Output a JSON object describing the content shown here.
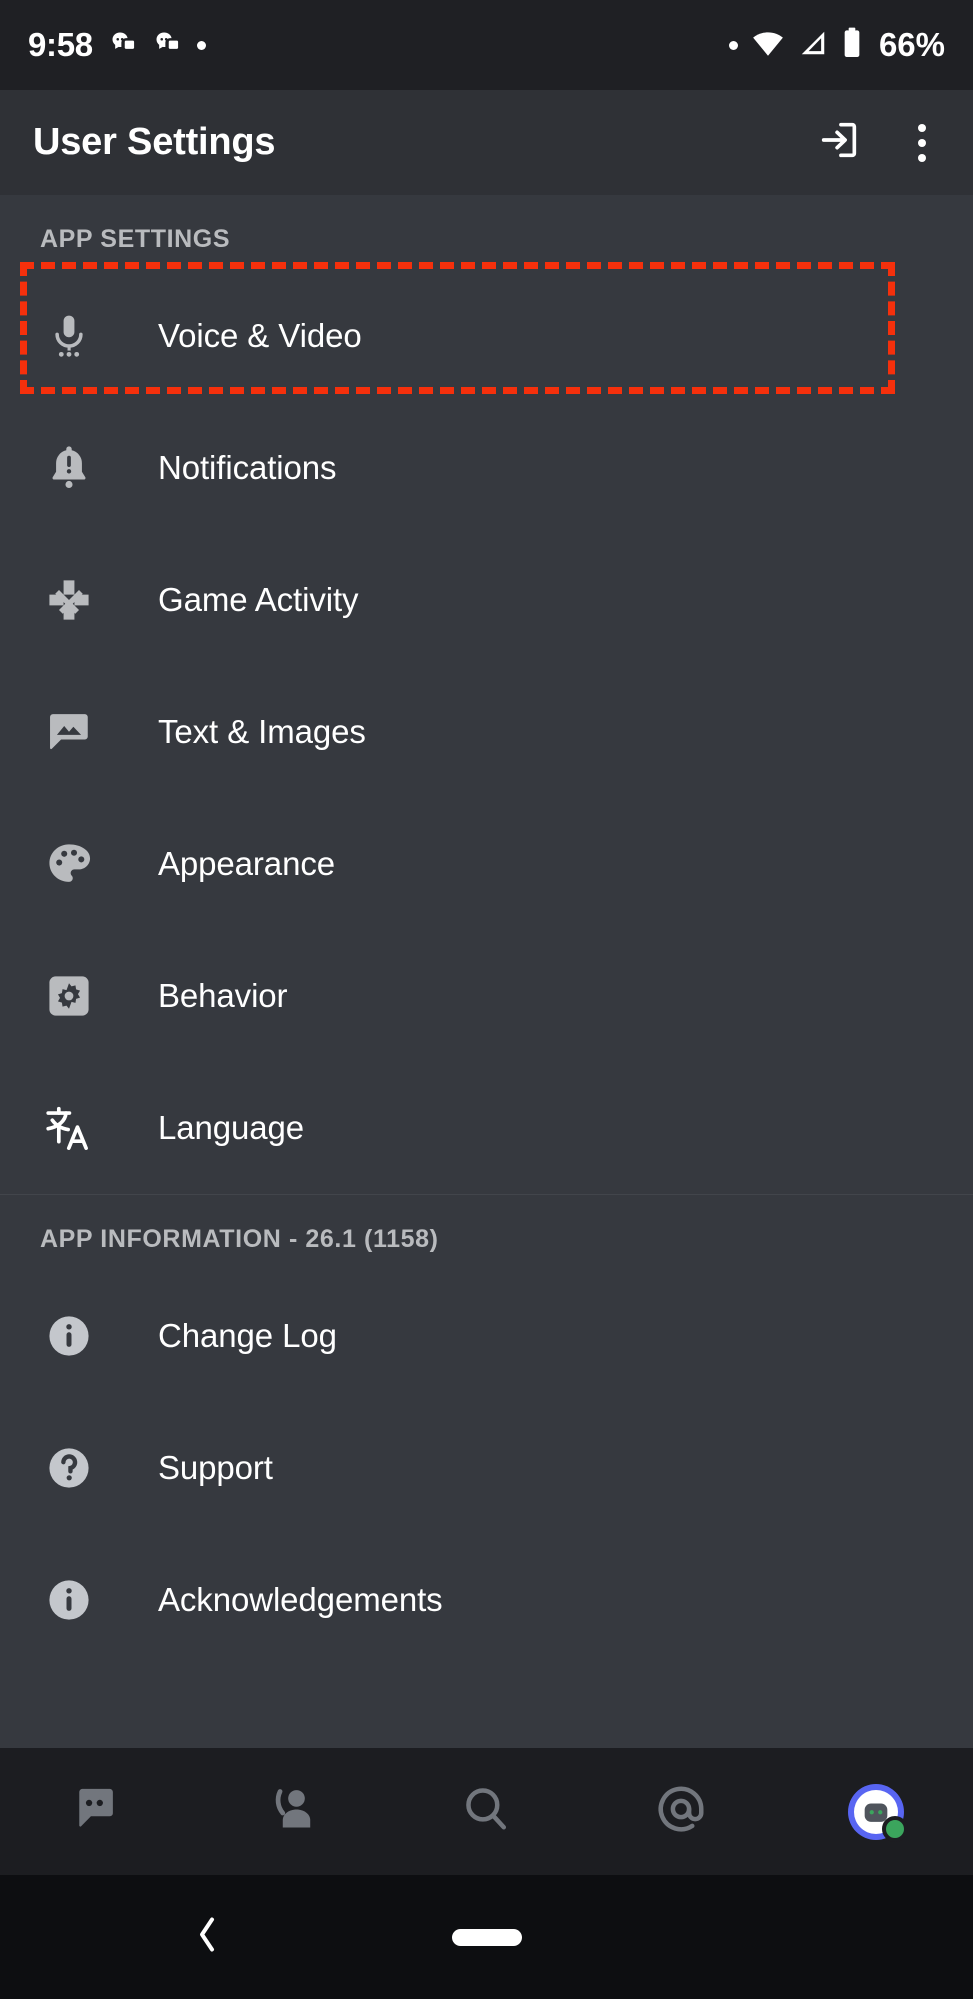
{
  "status_bar": {
    "time": "9:58",
    "battery_percent": "66%",
    "icons": [
      "discord-notification-icon",
      "discord-notification-icon",
      "dot-indicator-icon",
      "dot-indicator-icon",
      "wifi-icon",
      "cellular-signal-icon",
      "battery-icon"
    ]
  },
  "app_bar": {
    "title": "User Settings",
    "log_out_icon": "log-out-icon",
    "overflow_icon": "overflow-menu-icon"
  },
  "sections": [
    {
      "header": "APP SETTINGS",
      "items": [
        {
          "label": "Voice & Video",
          "icon": "microphone-icon",
          "highlighted": true
        },
        {
          "label": "Notifications",
          "icon": "bell-alert-icon",
          "highlighted": false
        },
        {
          "label": "Game Activity",
          "icon": "dpad-icon",
          "highlighted": false
        },
        {
          "label": "Text & Images",
          "icon": "chat-image-icon",
          "highlighted": false
        },
        {
          "label": "Appearance",
          "icon": "palette-icon",
          "highlighted": false
        },
        {
          "label": "Behavior",
          "icon": "gear-square-icon",
          "highlighted": false
        },
        {
          "label": "Language",
          "icon": "translate-icon",
          "highlighted": false
        }
      ]
    },
    {
      "header": "APP INFORMATION - 26.1 (1158)",
      "items": [
        {
          "label": "Change Log",
          "icon": "info-circle-icon",
          "highlighted": false
        },
        {
          "label": "Support",
          "icon": "question-circle-icon",
          "highlighted": false
        },
        {
          "label": "Acknowledgements",
          "icon": "info-circle-icon",
          "highlighted": false
        }
      ]
    }
  ],
  "bottom_nav": [
    {
      "name": "servers",
      "icon": "discord-logo-icon"
    },
    {
      "name": "friends",
      "icon": "friends-icon"
    },
    {
      "name": "search",
      "icon": "search-icon"
    },
    {
      "name": "mentions",
      "icon": "mention-at-icon"
    },
    {
      "name": "profile",
      "icon": "avatar-icon",
      "presence": "online"
    }
  ],
  "system_nav": {
    "back_icon": "back-chevron-icon",
    "home_icon": "home-pill-icon"
  },
  "colors": {
    "annotation": "#f5300c",
    "app_bar_bg": "#2f3136",
    "content_bg": "#36393f",
    "status_bar_bg": "#1f2024",
    "bottom_nav_bg": "#1c1d21",
    "icon_grey": "#b9bbbe",
    "online_green": "#3ba55d",
    "brand_blurple": "#5865f2"
  }
}
